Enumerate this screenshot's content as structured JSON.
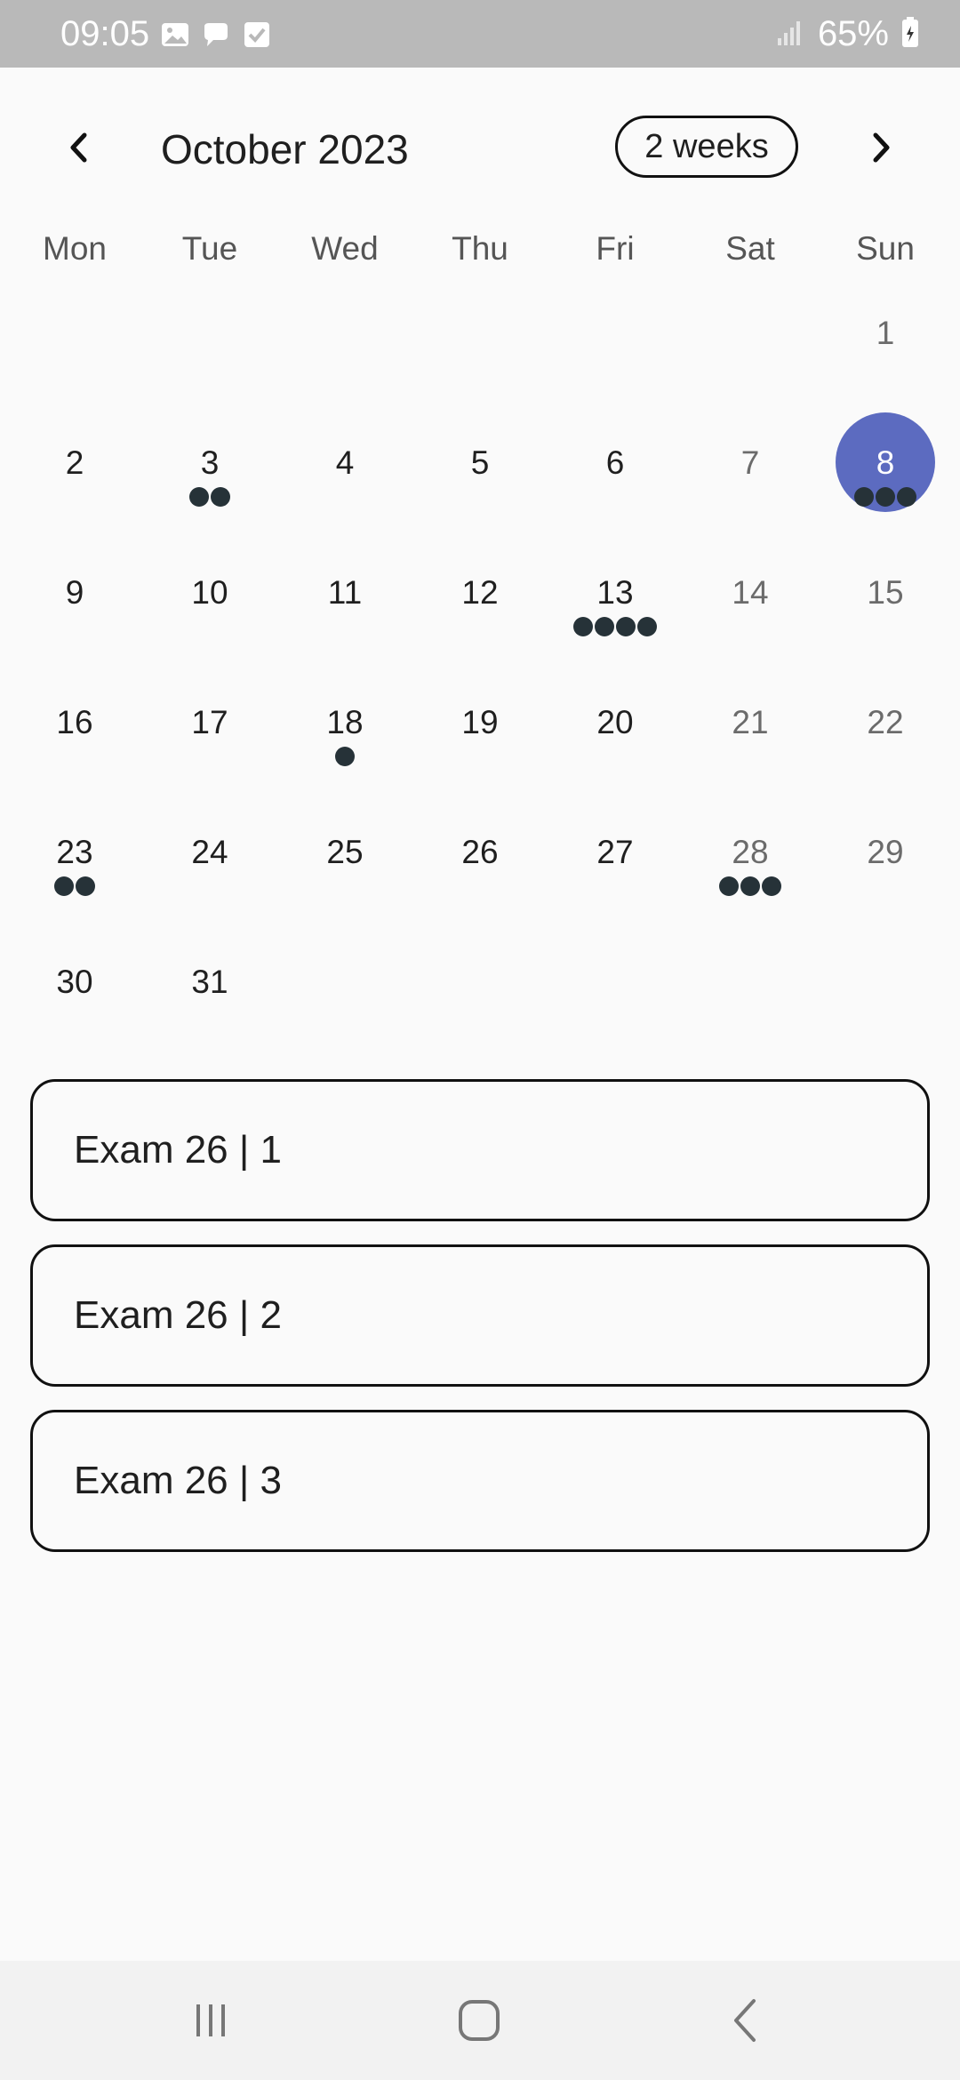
{
  "status_bar": {
    "time": "09:05",
    "battery": "65%",
    "left_icons": [
      "gallery-icon",
      "chat-bubble-icon",
      "checkbox-icon"
    ],
    "right_icons": [
      "signal-icon",
      "battery-charging-icon"
    ]
  },
  "calendar": {
    "month_title": "October 2023",
    "format_button": "2 weeks",
    "weekdays": [
      "Mon",
      "Tue",
      "Wed",
      "Thu",
      "Fri",
      "Sat",
      "Sun"
    ],
    "selected_day": "8",
    "selected_color": "#5c6bc0",
    "marker_color": "#263238",
    "weeks": [
      [
        {
          "day": "",
          "markers": 0
        },
        {
          "day": "",
          "markers": 0
        },
        {
          "day": "",
          "markers": 0
        },
        {
          "day": "",
          "markers": 0
        },
        {
          "day": "",
          "markers": 0
        },
        {
          "day": "",
          "markers": 0
        },
        {
          "day": "1",
          "markers": 0
        }
      ],
      [
        {
          "day": "2",
          "markers": 0
        },
        {
          "day": "3",
          "markers": 2
        },
        {
          "day": "4",
          "markers": 0
        },
        {
          "day": "5",
          "markers": 0
        },
        {
          "day": "6",
          "markers": 0
        },
        {
          "day": "7",
          "markers": 0
        },
        {
          "day": "8",
          "markers": 3
        }
      ],
      [
        {
          "day": "9",
          "markers": 0
        },
        {
          "day": "10",
          "markers": 0
        },
        {
          "day": "11",
          "markers": 0
        },
        {
          "day": "12",
          "markers": 0
        },
        {
          "day": "13",
          "markers": 4
        },
        {
          "day": "14",
          "markers": 0
        },
        {
          "day": "15",
          "markers": 0
        }
      ],
      [
        {
          "day": "16",
          "markers": 0
        },
        {
          "day": "17",
          "markers": 0
        },
        {
          "day": "18",
          "markers": 1
        },
        {
          "day": "19",
          "markers": 0
        },
        {
          "day": "20",
          "markers": 0
        },
        {
          "day": "21",
          "markers": 0
        },
        {
          "day": "22",
          "markers": 0
        }
      ],
      [
        {
          "day": "23",
          "markers": 2
        },
        {
          "day": "24",
          "markers": 0
        },
        {
          "day": "25",
          "markers": 0
        },
        {
          "day": "26",
          "markers": 0
        },
        {
          "day": "27",
          "markers": 0
        },
        {
          "day": "28",
          "markers": 3
        },
        {
          "day": "29",
          "markers": 0
        }
      ],
      [
        {
          "day": "30",
          "markers": 0
        },
        {
          "day": "31",
          "markers": 0
        },
        {
          "day": "",
          "markers": 0
        },
        {
          "day": "",
          "markers": 0
        },
        {
          "day": "",
          "markers": 0
        },
        {
          "day": "",
          "markers": 0
        },
        {
          "day": "",
          "markers": 0
        }
      ]
    ]
  },
  "events": [
    {
      "title": "Exam 26 | 1"
    },
    {
      "title": "Exam 26 | 2"
    },
    {
      "title": "Exam 26 | 3"
    }
  ],
  "navigation_bar": {
    "buttons": [
      "recent-apps-icon",
      "home-icon",
      "back-icon"
    ]
  }
}
